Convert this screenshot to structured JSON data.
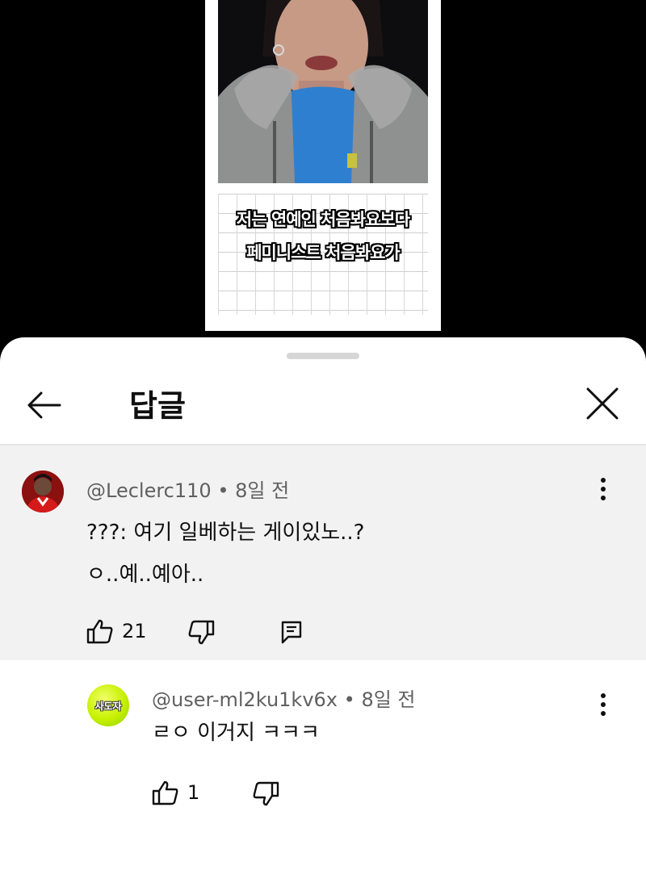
{
  "video": {
    "caption_line1": "저는 연예인 처음봐요보다",
    "caption_line2": "페미니스트 처음봐요가"
  },
  "sheet": {
    "title": "답글"
  },
  "comments": [
    {
      "author": "@Leclerc110",
      "time": "8일 전",
      "lines": [
        "???: 여기 일베하는 게이있노..?",
        "ㅇ..예..예아.."
      ],
      "likes": "21"
    },
    {
      "author": "@user-ml2ku1kv6x",
      "time": "8일 전",
      "avatar_text": "사도자",
      "lines": [
        "ㄹㅇ 이거지 ㅋㅋㅋ"
      ],
      "likes": "1"
    }
  ],
  "colors": {
    "highlight_bg": "#f2f2f2",
    "text": "#0f0f0f",
    "meta": "#606060"
  }
}
